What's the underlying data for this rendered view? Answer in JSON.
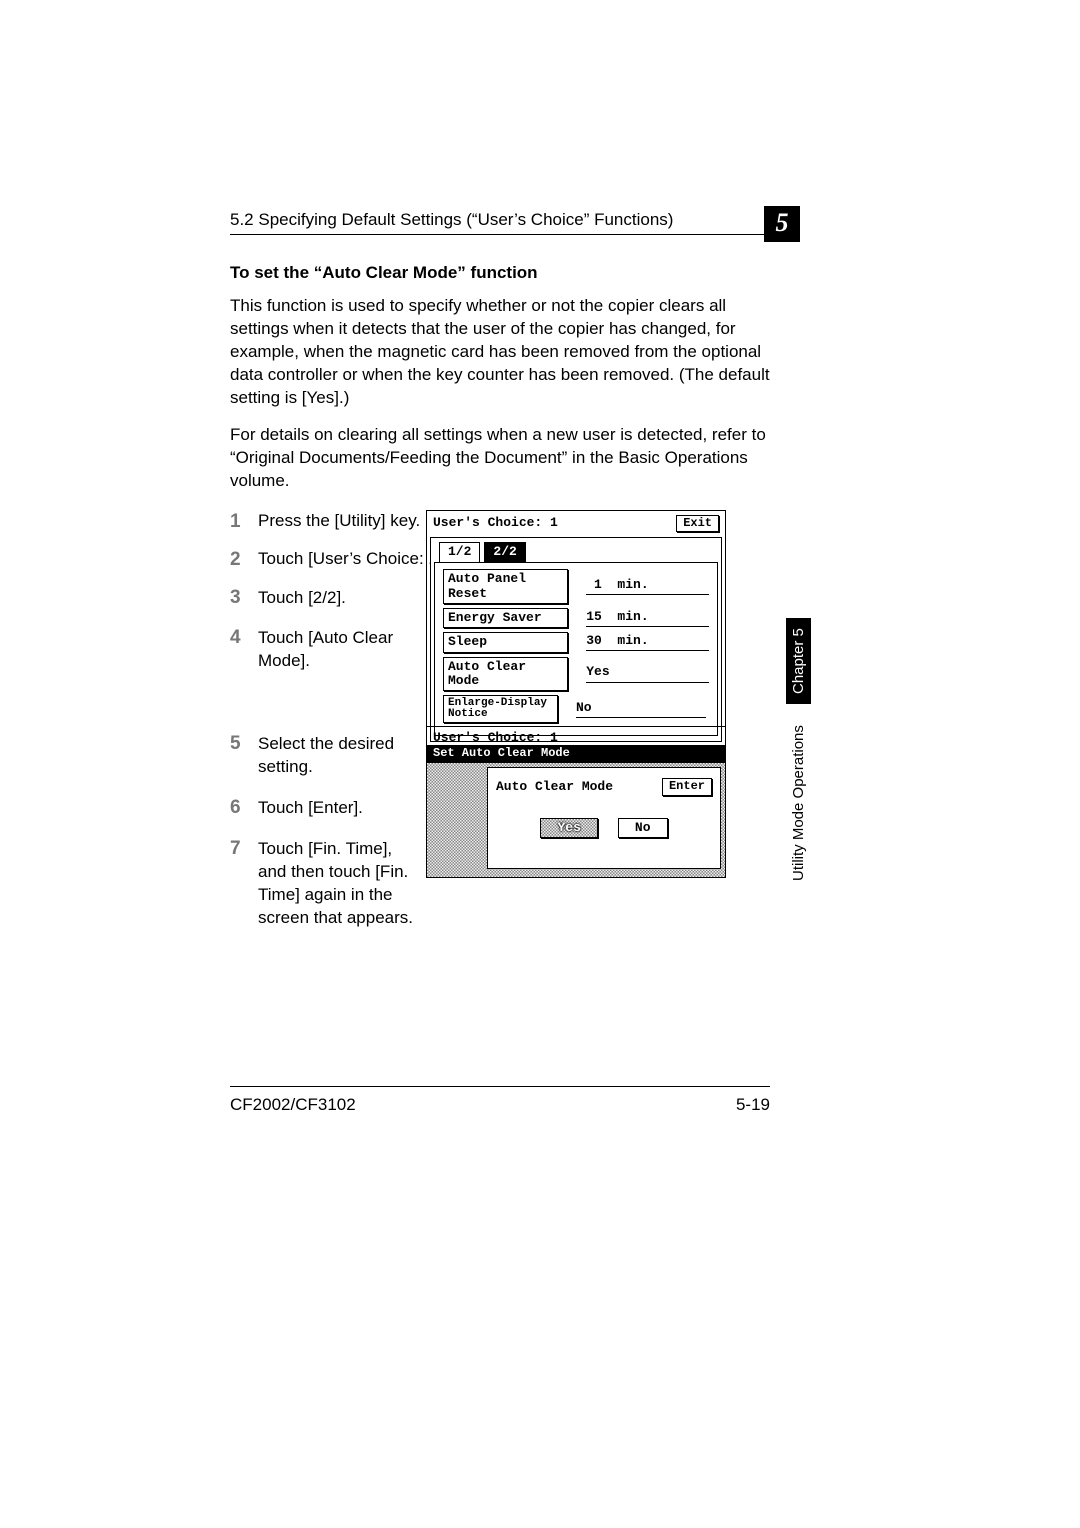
{
  "header": {
    "section": "5.2 Specifying Default Settings (“User’s Choice” Functions)",
    "chapter_number": "5"
  },
  "title": "To set the “Auto Clear Mode” function",
  "para1": "This function is used to specify whether or not the copier clears all settings when it detects that the user of the copier has changed, for example, when the magnetic card has been removed from the optional data controller or when the key counter has been removed. (The default setting is [Yes].)",
  "para2": "For details on clearing all settings when a new user is detected, refer to “Original Documents/Feeding the Document” in the Basic Operations volume.",
  "steps": [
    "Press the [Utility] key.",
    "Touch [User’s Choice: 1].",
    "Touch [2/2].",
    "Touch [Auto Clear Mode].",
    "Select the desired setting.",
    "Touch [Enter].",
    "Touch [Fin. Time], and then touch [Fin. Time] again in the screen that appears."
  ],
  "screen1": {
    "title": "User's Choice: 1",
    "exit": "Exit",
    "tab1": "1/2",
    "tab2": "2/2",
    "rows": [
      {
        "label": "Auto Panel Reset",
        "value": " 1  min."
      },
      {
        "label": "Energy Saver",
        "value": "15  min."
      },
      {
        "label": "Sleep",
        "value": "30  min."
      },
      {
        "label": "Auto Clear Mode",
        "value": "Yes"
      },
      {
        "label": "Enlarge-Display\nNotice",
        "value": "No"
      }
    ]
  },
  "screen2": {
    "title": "User's Choice: 1",
    "subtitle": "Set Auto Clear Mode",
    "heading": "Auto Clear Mode",
    "enter": "Enter",
    "yes": "Yes",
    "no": "No"
  },
  "side": {
    "chapter": "Chapter 5",
    "section": "Utility Mode Operations"
  },
  "footer": {
    "model": "CF2002/CF3102",
    "page": "5-19"
  }
}
